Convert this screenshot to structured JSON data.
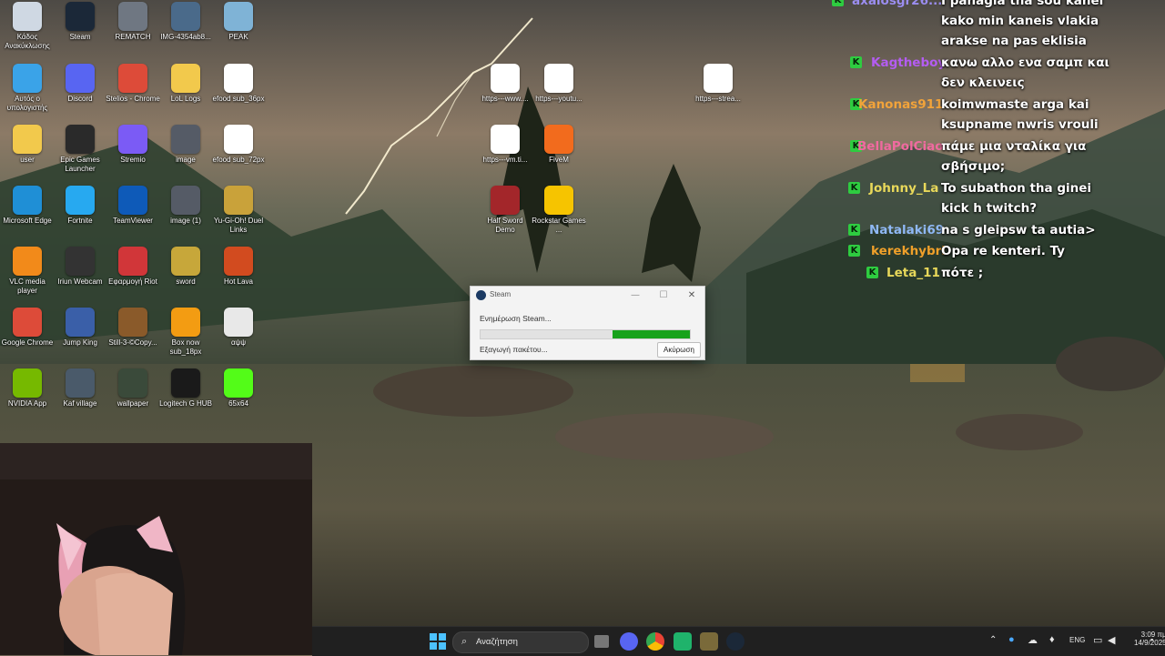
{
  "desktop_icons": [
    {
      "label": "Κάδος Ανακύκλωσης",
      "icon": "recycle-bin-icon",
      "color": "#cfd8e3"
    },
    {
      "label": "Steam",
      "icon": "steam-icon",
      "color": "#1b2838"
    },
    {
      "label": "REMATCH",
      "icon": "rematch-icon",
      "color": "#6f7782"
    },
    {
      "label": "IMG-4354ab8...",
      "icon": "image-file-icon",
      "color": "#4a6a8a"
    },
    {
      "label": "PEAK",
      "icon": "peak-icon",
      "color": "#7fb3d6"
    },
    {
      "label": "Αυτός ο υπολογιστής",
      "icon": "computer-icon",
      "color": "#3aa3e8"
    },
    {
      "label": "Discord",
      "icon": "discord-icon",
      "color": "#5865f2"
    },
    {
      "label": "Stelios - Chrome",
      "icon": "chrome-icon",
      "color": "#dd4b39"
    },
    {
      "label": "LoL Logs",
      "icon": "folder-icon",
      "color": "#f2c94c"
    },
    {
      "label": "efood sub_36px",
      "icon": "png-file-icon",
      "color": "#ffffff"
    },
    {
      "label": "user",
      "icon": "folder-icon",
      "color": "#f2c94c"
    },
    {
      "label": "Epic Games Launcher",
      "icon": "epic-games-icon",
      "color": "#2a2a2a"
    },
    {
      "label": "Stremio",
      "icon": "stremio-icon",
      "color": "#7b5bf5"
    },
    {
      "label": "image",
      "icon": "image-file-icon",
      "color": "#555b66"
    },
    {
      "label": "efood sub_72px",
      "icon": "png-file-icon",
      "color": "#ffffff"
    },
    {
      "label": "Microsoft Edge",
      "icon": "edge-icon",
      "color": "#1f8fd6"
    },
    {
      "label": "Fortnite",
      "icon": "fortnite-icon",
      "color": "#27a9f0"
    },
    {
      "label": "TeamViewer",
      "icon": "teamviewer-icon",
      "color": "#0e5ab8"
    },
    {
      "label": "image (1)",
      "icon": "image-file-icon",
      "color": "#555b66"
    },
    {
      "label": "Yu-Gi-Oh! Duel Links",
      "icon": "yugioh-icon",
      "color": "#c9a23a"
    },
    {
      "label": "VLC media player",
      "icon": "vlc-icon",
      "color": "#f28a1a"
    },
    {
      "label": "Iriun Webcam",
      "icon": "webcam-icon",
      "color": "#333333"
    },
    {
      "label": "Εφαρμογή Riot",
      "icon": "riot-icon",
      "color": "#d13639"
    },
    {
      "label": "sword",
      "icon": "sword-icon",
      "color": "#c7a73a"
    },
    {
      "label": "Hot Lava",
      "icon": "hot-lava-icon",
      "color": "#d24b1f"
    },
    {
      "label": "Google Chrome",
      "icon": "chrome-icon",
      "color": "#dd4b39"
    },
    {
      "label": "Jump King",
      "icon": "jump-king-icon",
      "color": "#3a5fa8"
    },
    {
      "label": "Still-3-©Copy...",
      "icon": "image-file-icon",
      "color": "#8a5a2a"
    },
    {
      "label": "Box now sub_18px",
      "icon": "png-file-icon",
      "color": "#f39c12"
    },
    {
      "label": "αψψ",
      "icon": "text-file-icon",
      "color": "#e8e8e8"
    },
    {
      "label": "NVIDIA App",
      "icon": "nvidia-icon",
      "color": "#76b900"
    },
    {
      "label": "Kaf village",
      "icon": "image-file-icon",
      "color": "#4a5a6a"
    },
    {
      "label": "wallpaper",
      "icon": "image-file-icon",
      "color": "#3a4a3a"
    },
    {
      "label": "Logitech G HUB",
      "icon": "logitech-icon",
      "color": "#1a1a1a"
    },
    {
      "label": "65x64",
      "icon": "kick-icon",
      "color": "#53fc18"
    },
    {
      "label": "https---www....",
      "icon": "chrome-shortcut-icon",
      "color": "#ffffff"
    },
    {
      "label": "https---youtu...",
      "icon": "chrome-shortcut-icon",
      "color": "#ffffff"
    },
    {
      "label": "https---strea...",
      "icon": "chrome-shortcut-icon",
      "color": "#ffffff"
    },
    {
      "label": "https---vm.ti...",
      "icon": "chrome-shortcut-icon",
      "color": "#ffffff"
    },
    {
      "label": "FiveM",
      "icon": "fivem-icon",
      "color": "#f26b1d"
    },
    {
      "label": "Half Sword Demo",
      "icon": "half-sword-icon",
      "color": "#a3262a"
    },
    {
      "label": "Rockstar Games ...",
      "icon": "rockstar-icon",
      "color": "#f6c400"
    }
  ],
  "chat": [
    {
      "user": "axalosgr26...",
      "color": "#9b8df0",
      "text": "I panagia tha sou kanei kako min kaneis vlakia arakse na pas eklisia"
    },
    {
      "user": "Kagtheboy",
      "color": "#b45cf2",
      "text": "κανω αλλο ενα σαμπ και δεν κλεινεις"
    },
    {
      "user": "Kanonas911",
      "color": "#f2a33a",
      "text": "koimwmaste arga kai ksupname nwris vrouli"
    },
    {
      "user": "BellaPolCiao",
      "color": "#f06aa0",
      "text": "πάμε μια νταλίκα για σβήσιμο;"
    },
    {
      "user": "Johnny_La",
      "color": "#e8d85a",
      "text": "To subathon tha ginei kick h twitch?"
    },
    {
      "user": "Natalaki69",
      "color": "#8fb8f5",
      "text": "na s gleipsw ta autia>"
    },
    {
      "user": "kerekhybri",
      "color": "#f0a02a",
      "text": "Opa re kenteri. Ty"
    },
    {
      "user": "Leta_11",
      "color": "#e8d85a",
      "text": "πότε ;"
    }
  ],
  "chat_badge": "K",
  "steam_dialog": {
    "title": "Steam",
    "status": "Ενημέρωση Steam...",
    "progress": 0.37,
    "substatus": "Εξαγωγή πακέτου...",
    "cancel": "Ακύρωση",
    "minimize": "—",
    "maximize": "☐",
    "close": "✕"
  },
  "taskbar": {
    "search_placeholder": "Αναζήτηση",
    "language": "ENG",
    "time": "3:09 πμ",
    "date": "14/9/2025"
  }
}
